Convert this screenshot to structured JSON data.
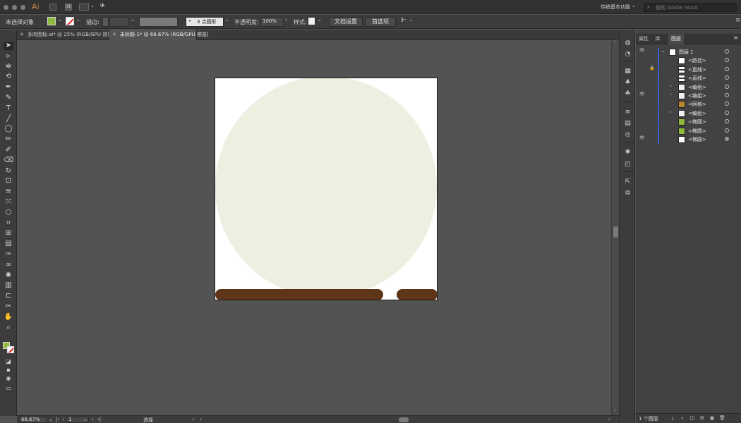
{
  "app": {
    "logo": "Ai",
    "workspace": "传统基本功能",
    "stock_search_placeholder": "搜索 Adobe Stock"
  },
  "control_bar": {
    "selection_status": "未选择对象",
    "stroke_label": "描边:",
    "brush_label": "3 点圆形",
    "opacity_label": "不透明度:",
    "opacity_value": "100%",
    "style_label": "样式:",
    "doc_setup_button": "文档设置",
    "preferences_button": "首选项"
  },
  "colors": {
    "fill": "#8fba3e",
    "circle": "#eeefe1",
    "bars": "#5e3517",
    "artboard": "#ffffff",
    "layer_accent": "#3d5ec9"
  },
  "doc_tabs": [
    {
      "title": "多肉图标.ai* @ 25% (RGB/GPU 预览)",
      "active": false
    },
    {
      "title": "未标题-1* @ 66.67% (RGB/GPU 预览)",
      "active": true
    }
  ],
  "panel": {
    "tabs": [
      "属性",
      "库",
      "图层"
    ],
    "active_tab": "图层",
    "layer_count": "1 个图层",
    "rows": [
      {
        "name": "图层 1",
        "depth": 0,
        "expanded": true,
        "eye": true,
        "lock": false,
        "thumb": "layer"
      },
      {
        "name": "<路径>",
        "depth": 1,
        "eye": false,
        "lock": false,
        "thumb": "path"
      },
      {
        "name": "<直线>",
        "depth": 1,
        "eye": false,
        "lock": true,
        "thumb": "line"
      },
      {
        "name": "<直线>",
        "depth": 1,
        "eye": false,
        "lock": false,
        "thumb": "line"
      },
      {
        "name": "<编组>",
        "depth": 1,
        "expandable": true,
        "eye": false,
        "lock": false,
        "thumb": "group"
      },
      {
        "name": "<编组>",
        "depth": 1,
        "expandable": true,
        "eye": true,
        "lock": false,
        "thumb": "group"
      },
      {
        "name": "<网格>",
        "depth": 1,
        "eye": false,
        "lock": false,
        "thumb": "mesh"
      },
      {
        "name": "<编组>",
        "depth": 1,
        "expandable": true,
        "eye": false,
        "lock": false,
        "thumb": "group"
      },
      {
        "name": "<椭圆>",
        "depth": 1,
        "eye": false,
        "lock": false,
        "thumb": "green"
      },
      {
        "name": "<椭圆>",
        "depth": 1,
        "eye": false,
        "lock": false,
        "thumb": "green"
      },
      {
        "name": "<椭圆>",
        "depth": 1,
        "eye": true,
        "lock": false,
        "thumb": "white",
        "target_filled": true
      }
    ]
  },
  "status_bar": {
    "zoom": "66.67%",
    "artboard_num": "1",
    "tool_name": "选择"
  },
  "icons": {
    "tools": [
      "selection-tool-icon",
      "direct-selection-tool-icon",
      "magic-wand-icon",
      "lasso-icon",
      "pen-tool-icon",
      "curvature-tool-icon",
      "type-tool-icon",
      "line-tool-icon",
      "ellipse-tool-icon",
      "paintbrush-icon",
      "shaper-tool-icon",
      "eraser-icon",
      "rotate-tool-icon",
      "scale-tool-icon",
      "warp-tool-icon",
      "free-transform-icon",
      "shape-builder-icon",
      "perspective-grid-icon",
      "mesh-tool-icon",
      "gradient-tool-icon",
      "eyedropper-icon",
      "blend-tool-icon",
      "symbol-sprayer-icon",
      "column-graph-icon",
      "artboard-tool-icon",
      "slice-tool-icon",
      "hand-tool-icon",
      "zoom-tool-icon"
    ]
  }
}
